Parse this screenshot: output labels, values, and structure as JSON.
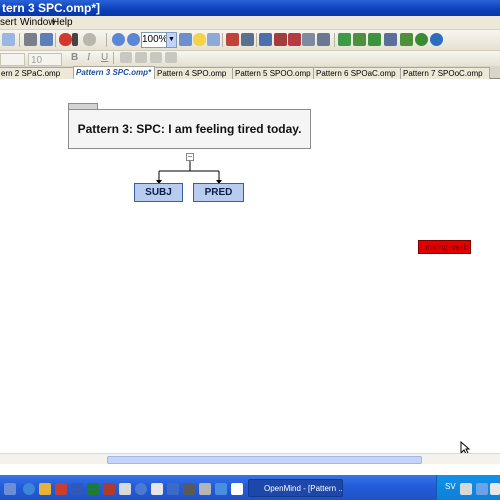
{
  "window": {
    "title": "tern 3 SPC.omp*]"
  },
  "menu": {
    "items": [
      "sert",
      "Window",
      "Help"
    ]
  },
  "toolbar": {
    "zoom": "100%"
  },
  "format_toolbar": {
    "font_size": "10",
    "bold": "B",
    "italic": "I",
    "underline": "U"
  },
  "tabs": [
    {
      "label": "ern 2 SPaC.omp",
      "active": false
    },
    {
      "label": "Pattern 3 SPC.omp*",
      "active": true
    },
    {
      "label": "Pattern 4 SPO.omp",
      "active": false
    },
    {
      "label": "Pattern 5 SPOO.omp",
      "active": false
    },
    {
      "label": "Pattern 6 SPOaC.omp",
      "active": false
    },
    {
      "label": "Pattern 7 SPOoC.omp",
      "active": false
    }
  ],
  "map": {
    "topic": "Pattern 3: SPC: I am feeling tired today.",
    "collapse_symbol": "−",
    "children": [
      "SUBJ",
      "PRED"
    ],
    "floating_label": "Linking verb"
  },
  "taskbar": {
    "task_label": "OpenMind - [Pattern ...",
    "lang": "SV"
  },
  "colors": {
    "node_fill": "#b8ccf0",
    "node_border": "#3b5e9c",
    "badge": "#e30000",
    "titlebar": "#0a3fb8",
    "taskbar": "#245edb"
  }
}
